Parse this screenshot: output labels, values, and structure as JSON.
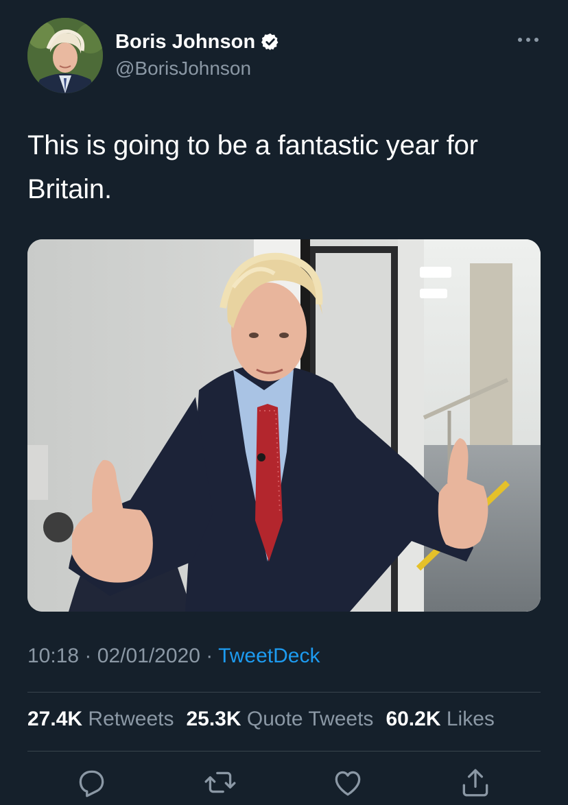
{
  "tweet": {
    "display_name": "Boris Johnson",
    "handle": "@BorisJohnson",
    "text_line1": "This is going to be a fantastic year for",
    "text_line2": "Britain.",
    "time": "10:18",
    "date": "02/01/2020",
    "source": "TweetDeck",
    "separator": "·"
  },
  "stats": {
    "retweets_count": "27.4K",
    "retweets_label": "Retweets",
    "quotes_count": "25.3K",
    "quotes_label": "Quote Tweets",
    "likes_count": "60.2K",
    "likes_label": "Likes"
  },
  "icons": {
    "verified": "verified-badge-icon",
    "more": "more-options-icon",
    "reply": "reply-icon",
    "retweet": "retweet-icon",
    "like": "heart-icon",
    "share": "share-icon"
  },
  "colors": {
    "background": "#15202b",
    "text_primary": "#ffffff",
    "text_secondary": "#8b98a5",
    "link": "#1d9bf0",
    "divider": "#38444d"
  }
}
